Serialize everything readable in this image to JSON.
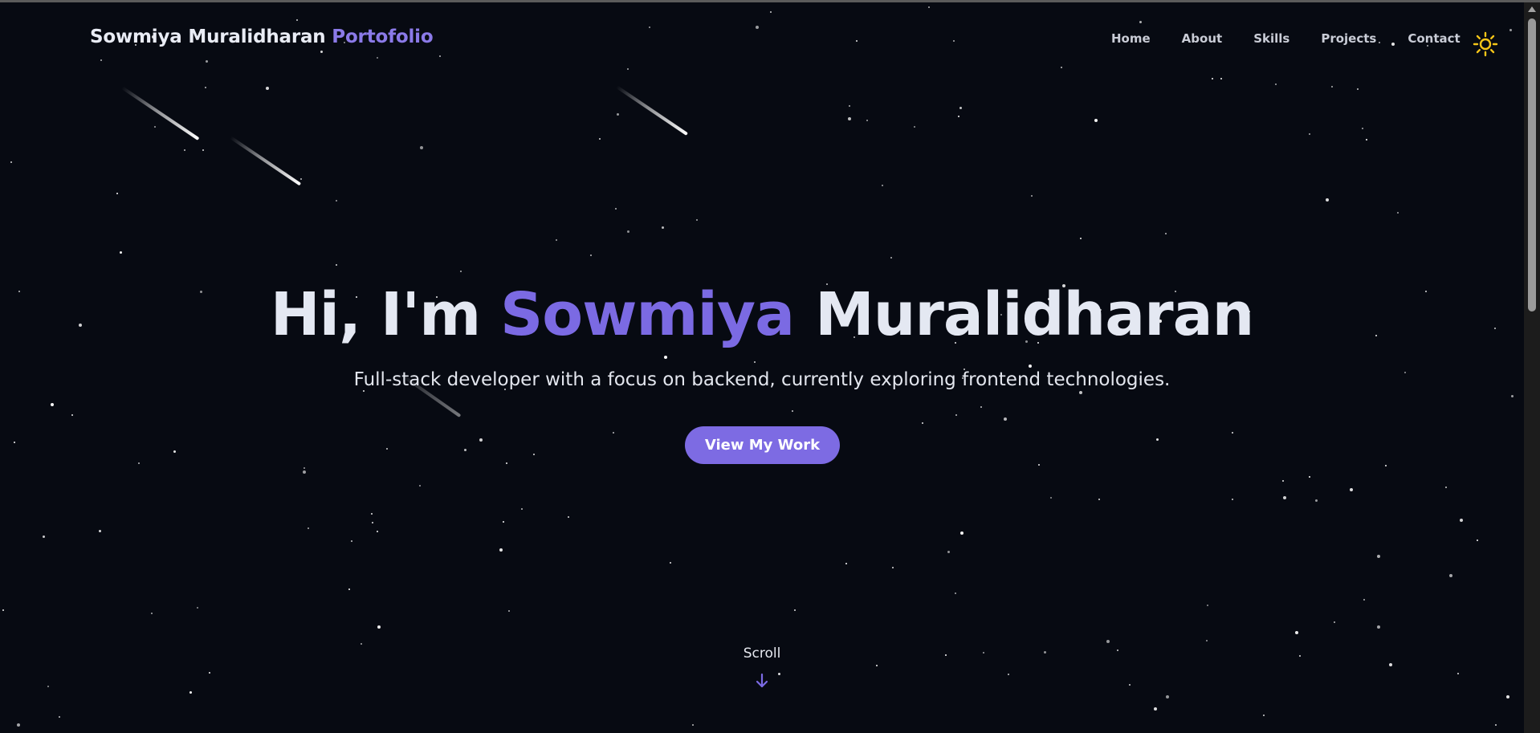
{
  "nav": {
    "brand_name": "Sowmiya Muralidharan",
    "brand_accent": "Portofolio",
    "links": [
      "Home",
      "About",
      "Skills",
      "Projects",
      "Contact"
    ],
    "theme_icon": "sun-icon"
  },
  "hero": {
    "greeting": "Hi, I'm",
    "first_name": "Sowmiya",
    "last_name": "Muralidharan",
    "subtitle": "Full-stack developer with a focus on backend, currently exploring frontend technologies.",
    "cta_label": "View My Work"
  },
  "scroll": {
    "label": "Scroll",
    "icon": "arrow-down-icon"
  },
  "colors": {
    "background": "#070a12",
    "accent": "#7b6ae3",
    "text": "#e4e8f2",
    "sun": "#f5c518"
  }
}
